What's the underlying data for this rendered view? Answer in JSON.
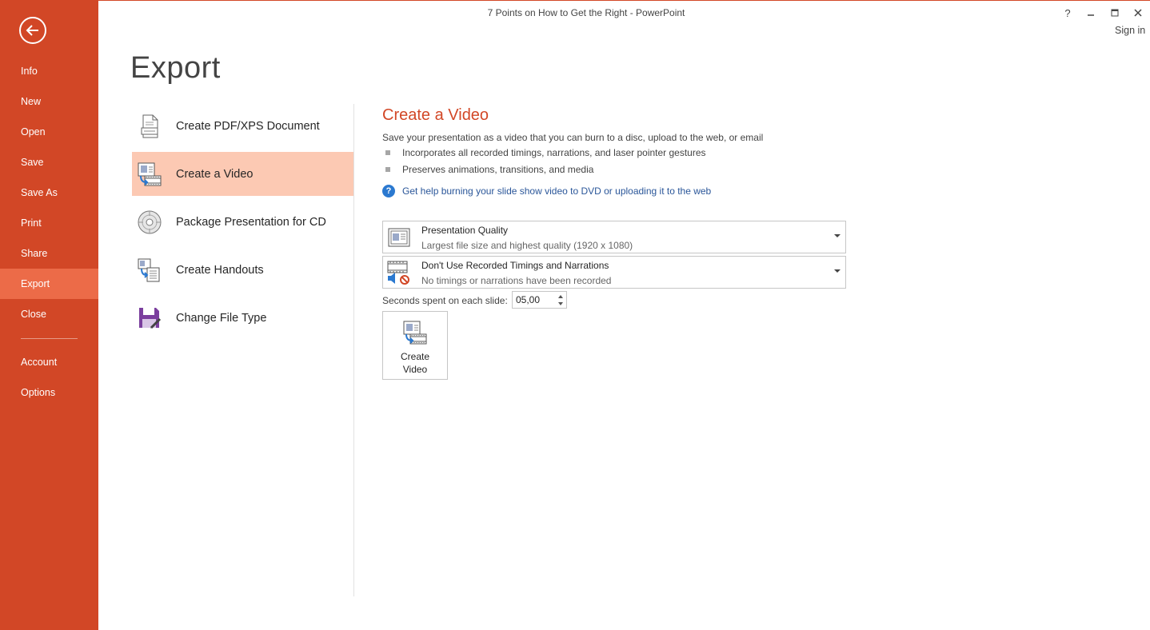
{
  "window": {
    "title": "7 Points on How to Get the Right - PowerPoint",
    "help": "?",
    "minimize": "–",
    "maximize": "□",
    "close": "✕",
    "sign_in": "Sign in"
  },
  "sidebar": {
    "items": [
      {
        "label": "Info"
      },
      {
        "label": "New"
      },
      {
        "label": "Open"
      },
      {
        "label": "Save"
      },
      {
        "label": "Save As"
      },
      {
        "label": "Print"
      },
      {
        "label": "Share"
      },
      {
        "label": "Export"
      },
      {
        "label": "Close"
      },
      {
        "label": "Account"
      },
      {
        "label": "Options"
      }
    ],
    "active": "Export"
  },
  "page": {
    "title": "Export"
  },
  "options": [
    {
      "label": "Create PDF/XPS Document",
      "icon": "pdf-document-icon"
    },
    {
      "label": "Create a Video",
      "icon": "video-icon"
    },
    {
      "label": "Package Presentation for CD",
      "icon": "cd-icon"
    },
    {
      "label": "Create Handouts",
      "icon": "handouts-icon"
    },
    {
      "label": "Change File Type",
      "icon": "save-file-type-icon"
    }
  ],
  "detail": {
    "title": "Create a Video",
    "description": "Save your presentation as a video that you can burn to a disc, upload to the web, or email",
    "bullets": [
      "Incorporates all recorded timings, narrations, and laser pointer gestures",
      "Preserves animations, transitions, and media"
    ],
    "help_link": "Get help burning your slide show video to DVD or uploading it to the web",
    "quality": {
      "main": "Presentation Quality",
      "sub": "Largest file size and highest quality (1920 x 1080)"
    },
    "timings": {
      "main": "Don't Use Recorded Timings and Narrations",
      "sub": "No timings or narrations have been recorded"
    },
    "seconds_label": "Seconds spent on each slide:",
    "seconds_value": "05,00",
    "create_button_line1": "Create",
    "create_button_line2": "Video"
  },
  "colors": {
    "accent": "#d24726",
    "sidebar_active": "#ec6b48",
    "selected_option": "#fcc9b3",
    "link": "#2a5699"
  }
}
